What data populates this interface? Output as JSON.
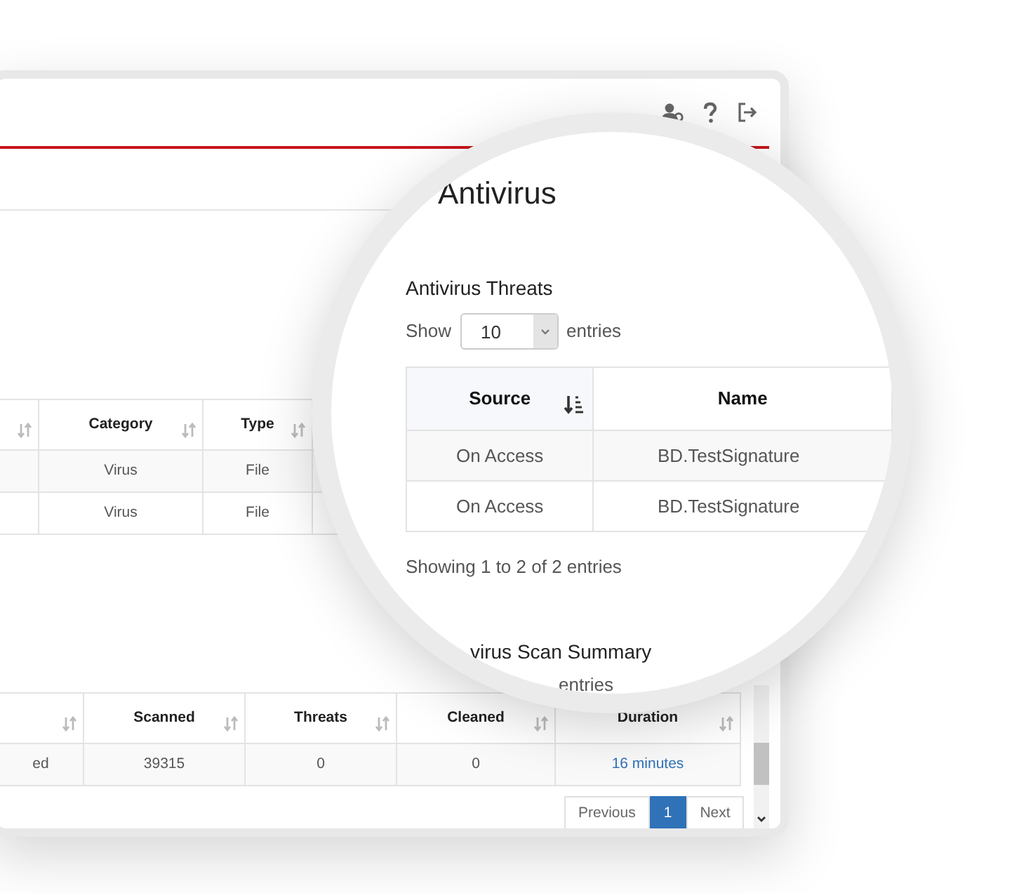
{
  "threats_table": {
    "columns": [
      {
        "sorted": false
      },
      {
        "label": "Category",
        "sorted": false
      },
      {
        "label": "Type",
        "sorted": false
      }
    ],
    "rows": [
      [
        "",
        "Virus",
        "File"
      ],
      [
        "",
        "Virus",
        "File"
      ]
    ]
  },
  "scan_table": {
    "columns": [
      {
        "sorted": false
      },
      {
        "label": "Scanned",
        "sorted": false
      },
      {
        "label": "Threats",
        "sorted": false
      },
      {
        "label": "Cleaned",
        "sorted": false
      },
      {
        "label": "Duration",
        "sorted": false,
        "link": true
      }
    ],
    "rows": [
      [
        "ed",
        "39315",
        "0",
        "0",
        "16 minutes"
      ]
    ]
  },
  "pagination": [
    {
      "label": "Previous",
      "selected": false
    },
    {
      "label": "1",
      "selected": true
    },
    {
      "label": "Next",
      "selected": false
    }
  ],
  "lens": {
    "title": "Antivirus",
    "threats": {
      "heading": "Antivirus Threats",
      "show_label": "Show",
      "page_size": "10",
      "entries_label": "entries",
      "columns": [
        {
          "label": "Source",
          "sorted": true
        },
        {
          "label": "Name"
        }
      ],
      "rows": [
        [
          "On Access",
          "BD.TestSignature"
        ],
        [
          "On Access",
          "BD.TestSignature"
        ]
      ],
      "info": "Showing 1 to 2 of 2 entries"
    },
    "scan_summary": {
      "heading": "virus Scan Summary",
      "entries_label": "entries"
    }
  }
}
